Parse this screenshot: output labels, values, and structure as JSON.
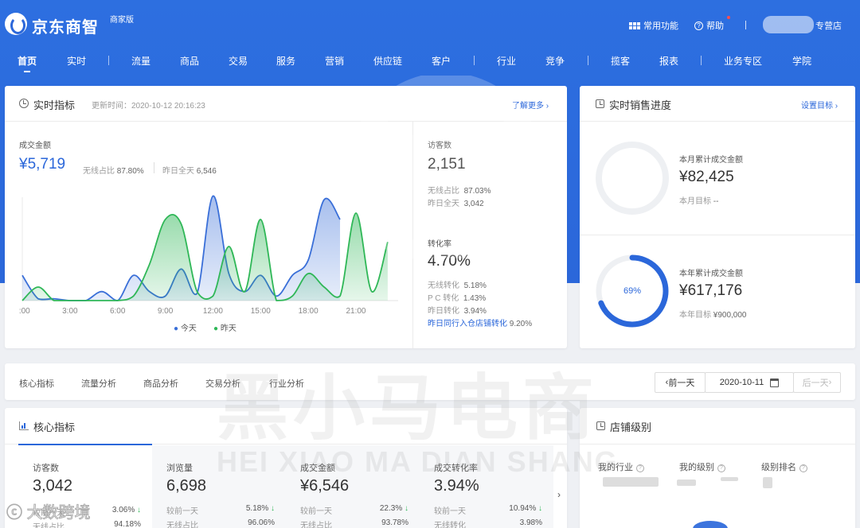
{
  "header": {
    "brand": "京东商智",
    "edition": "商家版",
    "tools": {
      "common": "常用功能",
      "help": "帮助",
      "shop": "专营店"
    }
  },
  "nav": [
    {
      "label": "首页",
      "active": true
    },
    {
      "label": "实时"
    },
    {
      "label": "流量"
    },
    {
      "label": "商品"
    },
    {
      "label": "交易"
    },
    {
      "label": "服务"
    },
    {
      "label": "营销"
    },
    {
      "label": "供应链"
    },
    {
      "label": "客户"
    },
    {
      "label": "行业"
    },
    {
      "label": "竞争"
    },
    {
      "label": "揽客"
    },
    {
      "label": "报表"
    },
    {
      "label": "业务专区"
    },
    {
      "label": "学院"
    }
  ],
  "realtime": {
    "title": "实时指标",
    "updated": "更新时间：2020-10-12 20:16:23",
    "more": "了解更多",
    "gmv": {
      "label": "成交金额",
      "value": "¥5,719",
      "wireless_label": "无线占比",
      "wireless": "87.80%",
      "yest_label": "昨日全天",
      "yest": "6,546"
    },
    "visitors": {
      "label": "访客数",
      "value": "2,151",
      "wireless_label": "无线占比",
      "wireless": "87.03%",
      "yest_label": "昨日全天",
      "yest": "3,042"
    },
    "conversion": {
      "label": "转化率",
      "value": "4.70%",
      "rows": [
        {
          "k": "无线转化",
          "v": "5.18%"
        },
        {
          "k": "P C 转化",
          "v": "1.43%"
        },
        {
          "k": "昨日转化",
          "v": "3.94%"
        }
      ],
      "peer_label": "昨日同行入仓店铺转化",
      "peer": "9.20%"
    }
  },
  "chart_data": {
    "type": "area",
    "x_ticks": [
      "0:00",
      "3:00",
      "6:00",
      "9:00",
      "12:00",
      "15:00",
      "18:00",
      "21:00"
    ],
    "series": [
      {
        "name": "今天",
        "color": "#3a6fd8",
        "x": [
          0,
          1,
          2,
          3,
          4,
          5,
          6,
          7,
          8,
          9,
          10,
          11,
          12,
          13,
          14,
          15,
          16,
          17,
          18,
          19,
          20
        ],
        "values": [
          28,
          2,
          2,
          0,
          0,
          10,
          0,
          28,
          10,
          5,
          35,
          8,
          116,
          30,
          10,
          28,
          5,
          28,
          45,
          112,
          90
        ]
      },
      {
        "name": "昨天",
        "color": "#2fb757",
        "x": [
          0,
          1,
          2,
          3,
          4,
          5,
          6,
          7,
          8,
          9,
          10,
          11,
          12,
          13,
          14,
          15,
          16,
          17,
          18,
          19,
          20,
          21,
          22,
          23
        ],
        "values": [
          0,
          15,
          0,
          0,
          0,
          0,
          0,
          5,
          40,
          90,
          85,
          10,
          5,
          60,
          10,
          90,
          0,
          5,
          30,
          15,
          5,
          97,
          10,
          65
        ]
      }
    ]
  },
  "sales_progress": {
    "title": "实时销售进度",
    "settings": "设置目标",
    "month": {
      "label": "本月累计成交金额",
      "value": "¥82,425",
      "target_label": "本月目标",
      "target": "--"
    },
    "year": {
      "label": "本年累计成交金额",
      "value": "¥617,176",
      "target_label": "本年目标",
      "target": "¥900,000",
      "percent": "69%",
      "fraction": 0.69
    }
  },
  "tabs": [
    "核心指标",
    "流量分析",
    "商品分析",
    "交易分析",
    "行业分析"
  ],
  "date_picker": {
    "prev": "前一天",
    "date": "2020-10-11",
    "next": "后一天"
  },
  "core_metrics": {
    "title": "核心指标",
    "tiles": [
      {
        "label": "访客数",
        "value": "3,042",
        "row1_label": "较前一天",
        "row1": "3.06%",
        "row2_label": "无线占比",
        "row2": "94.18%"
      },
      {
        "label": "浏览量",
        "value": "6,698",
        "row1_label": "较前一天",
        "row1": "5.18%",
        "row2_label": "无线占比",
        "row2": "96.06%"
      },
      {
        "label": "成交金额",
        "value": "¥6,546",
        "row1_label": "较前一天",
        "row1": "22.3%",
        "row2_label": "无线占比",
        "row2": "93.78%"
      },
      {
        "label": "成交转化率",
        "value": "3.94%",
        "row1_label": "较前一天",
        "row1": "10.94%",
        "row2_label": "无线转化",
        "row2": "3.98%"
      }
    ]
  },
  "shop_level": {
    "title": "店铺级别",
    "cols": [
      "我的行业",
      "我的级别",
      "级别排名"
    ]
  },
  "watermark": {
    "cn": "黑小马电商",
    "en": "HEI XIAO MA DIAN SHANG",
    "corner": "大数跨境"
  }
}
